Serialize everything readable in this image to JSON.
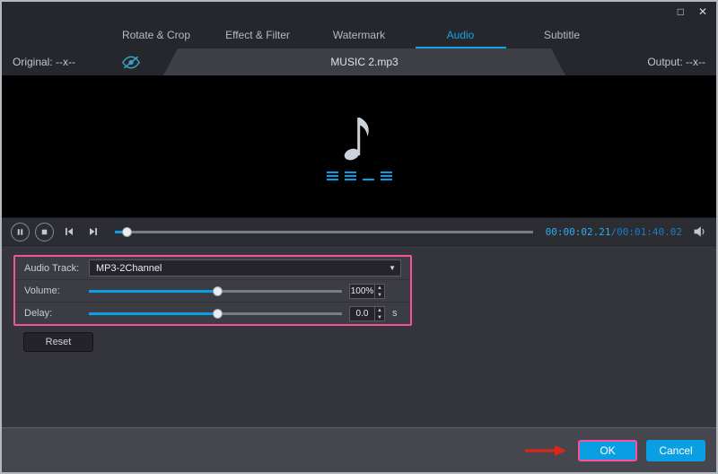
{
  "icons": {
    "maximize": "□",
    "close": "✕",
    "dropdown_arrow": "▼",
    "spinner_up": "▲",
    "spinner_down": "▼"
  },
  "tabs": [
    {
      "label": "Rotate & Crop",
      "active": false
    },
    {
      "label": "Effect & Filter",
      "active": false
    },
    {
      "label": "Watermark",
      "active": false
    },
    {
      "label": "Audio",
      "active": true
    },
    {
      "label": "Subtitle",
      "active": false
    }
  ],
  "preview_header": {
    "original_label": "Original: --x--",
    "filename": "MUSIC 2.mp3",
    "output_label": "Output: --x--"
  },
  "player": {
    "time_current": "00:00:02.21",
    "time_separator": "/",
    "time_total": "00:01:40.02",
    "progress_percent": 3
  },
  "audio_settings": {
    "audio_track": {
      "label": "Audio Track:",
      "value": "MP3-2Channel"
    },
    "volume": {
      "label": "Volume:",
      "value": "100%",
      "slider_percent": 51
    },
    "delay": {
      "label": "Delay:",
      "value": "0.0",
      "unit": "s",
      "slider_percent": 51
    }
  },
  "buttons": {
    "reset": "Reset",
    "ok": "OK",
    "cancel": "Cancel"
  },
  "colors": {
    "accent_blue": "#00a0e9",
    "panel_highlight_pink": "#f4539a",
    "button_border_pink": "#ff4e9d",
    "arrow_red": "#e02418",
    "button_blue": "#0a9ee2",
    "preview_background": "#000000"
  }
}
